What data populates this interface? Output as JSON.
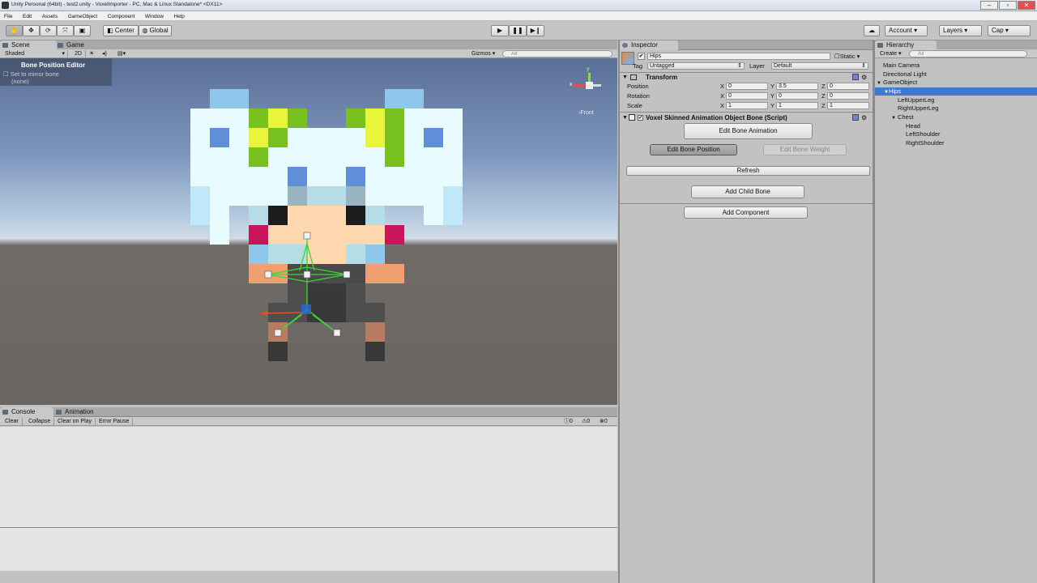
{
  "window": {
    "title": "Unity Personal (64bit) - test2.unity - VoxelImporter - PC, Mac & Linux Standalone* <DX11>"
  },
  "menu": [
    "File",
    "Edit",
    "Assets",
    "GameObject",
    "Component",
    "Window",
    "Help"
  ],
  "toolbar": {
    "center": "Center",
    "global": "Global",
    "account": "Account",
    "layers": "Layers",
    "layout": "Cap"
  },
  "scene_tabs": {
    "scene": "Scene",
    "game": "Game"
  },
  "scene_bar": {
    "shading": "Shaded",
    "mode2d": "2D",
    "gizmos": "Gizmos",
    "search": "All"
  },
  "bone_editor": {
    "title": "Bone Position Editor",
    "mirror": "Set to mirror bone",
    "none": "(none)"
  },
  "gizmo": {
    "front": "Front"
  },
  "inspector": {
    "tab": "Inspector",
    "name": "Hips",
    "static": "Static",
    "tag_label": "Tag",
    "tag_value": "Untagged",
    "layer_label": "Layer",
    "layer_value": "Default",
    "transform_title": "Transform",
    "rows": [
      {
        "label": "Position",
        "x": "0",
        "y": "3.5",
        "z": "0"
      },
      {
        "label": "Rotation",
        "x": "0",
        "y": "0",
        "z": "0"
      },
      {
        "label": "Scale",
        "x": "1",
        "y": "1",
        "z": "1"
      }
    ],
    "axis": {
      "x": "X",
      "y": "Y",
      "z": "Z"
    },
    "script_title": "Voxel Skinned Animation Object Bone (Script)",
    "edit_anim": "Edit Bone Animation",
    "edit_pos": "Edit Bone Position",
    "edit_weight": "Edit Bone Weight",
    "refresh": "Refresh",
    "add_child": "Add Child Bone",
    "add_component": "Add Component"
  },
  "hierarchy": {
    "tab": "Hierarchy",
    "create": "Create",
    "search": "All",
    "items": [
      "Main Camera",
      "Directional Light",
      "GameObject",
      "Hips",
      "LeftUpperLeg",
      "RightUpperLeg",
      "Chest",
      "Head",
      "LeftShoulder",
      "RightShoulder"
    ]
  },
  "console": {
    "tab": "Console",
    "anim_tab": "Animation",
    "clear": "Clear",
    "collapse": "Collapse",
    "clear_on_play": "Clear on Play",
    "error_pause": "Error Pause",
    "info_count": "0",
    "warn_count": "0",
    "error_count": "0"
  },
  "colors": {
    "accent_select": "#3d7ad6",
    "panel": "#c2c2c2",
    "bone": "#3fd23f"
  }
}
